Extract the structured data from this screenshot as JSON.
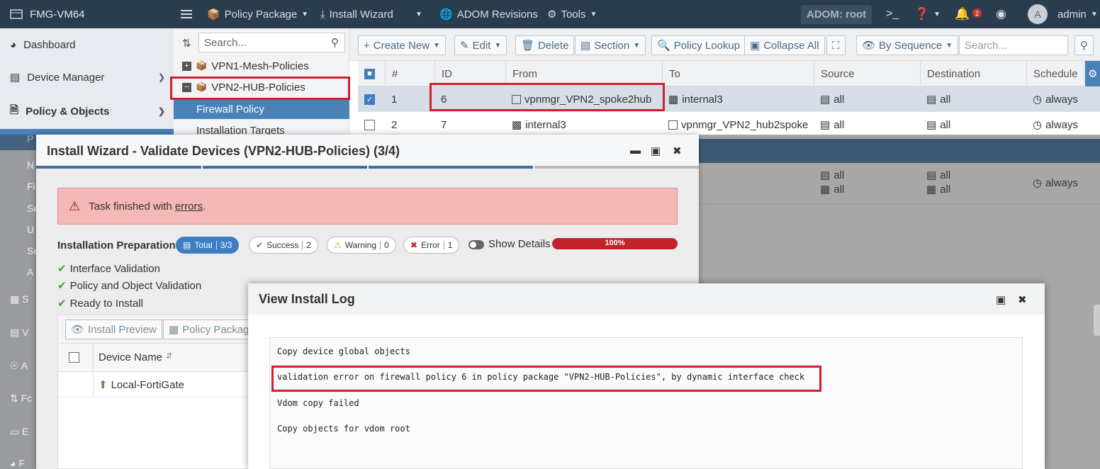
{
  "topbar": {
    "brand": "FMG-VM64",
    "policy_package": "Policy Package",
    "install_wizard": "Install Wizard",
    "adom_revisions": "ADOM Revisions",
    "tools": "Tools",
    "adom": "ADOM: root",
    "notif_count": "2",
    "avatar_letter": "A",
    "user": "admin"
  },
  "leftnav": {
    "items": [
      {
        "label": "Dashboard"
      },
      {
        "label": "Device Manager"
      },
      {
        "label": "Policy & Objects"
      }
    ],
    "selected_cut": "P",
    "cut_items": [
      "N",
      "Fi",
      "Se",
      "U",
      "Se",
      "A"
    ],
    "lower_cut": [
      "S",
      "V",
      "A",
      "Fc",
      "E",
      "F"
    ]
  },
  "tree": {
    "search_placeholder": "Search...",
    "packages": [
      "VPN1-Mesh-Policies",
      "VPN2-HUB-Policies"
    ],
    "sub": [
      "Firewall Policy",
      "Installation Targets"
    ]
  },
  "toolbar": {
    "create_new": "Create New",
    "edit": "Edit",
    "delete": "Delete",
    "section": "Section",
    "policy_lookup": "Policy Lookup",
    "collapse_all": "Collapse All",
    "by_sequence": "By Sequence",
    "search_placeholder": "Search..."
  },
  "table": {
    "headers": [
      "#",
      "ID",
      "From",
      "To",
      "Source",
      "Destination",
      "Schedule"
    ],
    "rows": [
      {
        "seq": "1",
        "id": "6",
        "from": "vpnmgr_VPN2_spoke2hub",
        "to": "internal3",
        "source": "all",
        "destination": "all",
        "schedule": "always",
        "checked": true
      },
      {
        "seq": "2",
        "id": "7",
        "from": "internal3",
        "to": "vpnmgr_VPN2_hub2spoke",
        "source": "all",
        "destination": "all",
        "schedule": "always",
        "checked": false
      }
    ],
    "row3": {
      "source1": "all",
      "source2": "all",
      "dest1": "all",
      "dest2": "all",
      "schedule": "always"
    }
  },
  "wizard": {
    "title": "Install Wizard - Validate Devices (VPN2-HUB-Policies) (3/4)",
    "alert_prefix": "Task finished with ",
    "alert_link": "errors",
    "alert_suffix": ".",
    "prep_label": "Installation Preparation",
    "total_label": "Total",
    "total_value": "3/3",
    "success_label": "Success",
    "success_value": "2",
    "warning_label": "Warning",
    "warning_value": "0",
    "error_label": "Error",
    "error_value": "1",
    "show_details": "Show Details",
    "progress_text": "100%",
    "progress": 1.0,
    "checks": [
      "Interface Validation",
      "Policy and Object Validation",
      "Ready to Install"
    ],
    "install_preview": "Install Preview",
    "policy_package_btn": "Policy Package",
    "device_name_header": "Device Name",
    "device": "Local-FortiGate"
  },
  "log": {
    "title": "View Install Log",
    "lines": [
      "Copy device global objects",
      "validation error on firewall policy 6 in policy package \"VPN2-HUB-Policies\", by dynamic interface check",
      "Vdom copy failed",
      "Copy objects for vdom root"
    ]
  },
  "colors": {
    "topbar": "#2a3d4f",
    "accent": "#3d7dc4",
    "highlight": "#d0202e",
    "error_bar": "#c0232b"
  }
}
